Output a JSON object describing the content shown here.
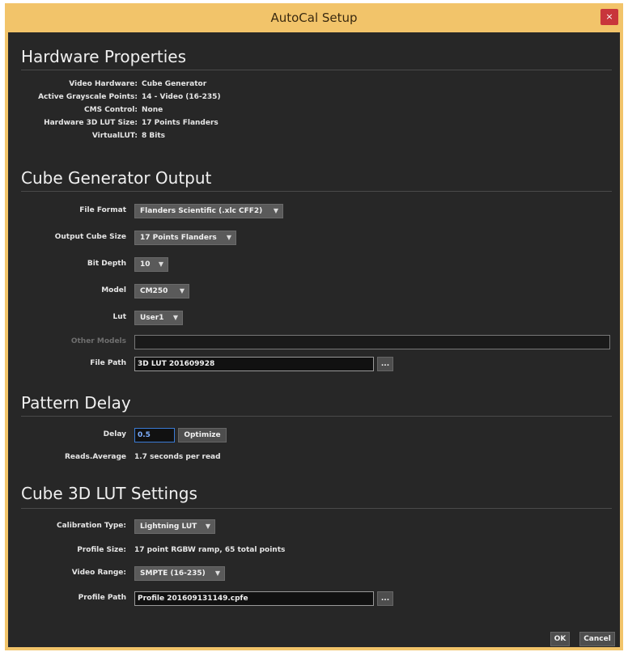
{
  "window": {
    "title": "AutoCal Setup",
    "close_glyph": "×"
  },
  "hardware": {
    "heading": "Hardware Properties",
    "rows": [
      {
        "label": "Video Hardware:",
        "value": "Cube Generator"
      },
      {
        "label": "Active Grayscale Points:",
        "value": "14 - Video (16-235)"
      },
      {
        "label": "CMS Control:",
        "value": "None"
      },
      {
        "label": "Hardware 3D LUT Size:",
        "value": "17 Points Flanders"
      },
      {
        "label": "VirtualLUT:",
        "value": "8 Bits"
      }
    ]
  },
  "cube_output": {
    "heading": "Cube Generator Output",
    "file_format": {
      "label": "File Format",
      "value": "Flanders Scientific (.xlc CFF2)"
    },
    "output_cube_size": {
      "label": "Output Cube Size",
      "value": "17 Points Flanders"
    },
    "bit_depth": {
      "label": "Bit Depth",
      "value": "10"
    },
    "model": {
      "label": "Model",
      "value": "CM250"
    },
    "lut": {
      "label": "Lut",
      "value": "User1"
    },
    "other_models": {
      "label": "Other Models",
      "value": ""
    },
    "file_path": {
      "label": "File Path",
      "value": "3D LUT 201609928",
      "browse": "..."
    }
  },
  "pattern_delay": {
    "heading": "Pattern Delay",
    "delay": {
      "label": "Delay",
      "value": "0.5"
    },
    "optimize_label": "Optimize",
    "reads": {
      "label": "Reads.Average",
      "value": "1.7  seconds per read"
    }
  },
  "lut_settings": {
    "heading": "Cube 3D LUT Settings",
    "calibration_type": {
      "label": "Calibration Type:",
      "value": "Lightning LUT"
    },
    "profile_size": {
      "label": "Profile Size:",
      "value": "17  point RGBW ramp,  65  total points"
    },
    "video_range": {
      "label": "Video Range:",
      "value": "SMPTE (16-235)"
    },
    "profile_path": {
      "label": "Profile Path",
      "value": "Profile 201609131149.cpfe",
      "browse": "..."
    }
  },
  "footer": {
    "ok_label": "OK",
    "cancel_label": "Cancel"
  },
  "colors": {
    "title_bar": "#f2c46a",
    "background": "#272727",
    "close": "#c8363b",
    "focus": "#3a7bd5"
  },
  "icons": {
    "dropdown": "chevron-down-icon",
    "close": "close-icon"
  }
}
